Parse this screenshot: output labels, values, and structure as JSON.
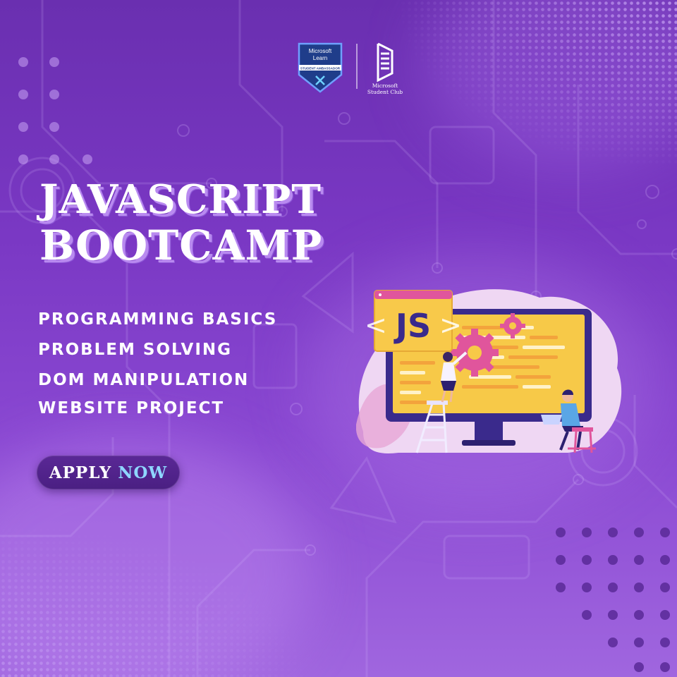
{
  "logos": {
    "badge_line1": "Microsoft",
    "badge_line2": "Learn",
    "badge_ribbon": "STUDENT AMBASSADOR",
    "club_line1": "Microsoft",
    "club_line2": "Student Club"
  },
  "headline": {
    "line1": "JAVASCRIPT",
    "line2": "BOOTCAMP"
  },
  "topics": [
    "PROGRAMMING BASICS",
    "PROBLEM SOLVING",
    "DOM MANIPULATION",
    "WEBSITE PROJECT"
  ],
  "cta": {
    "word1": "APPLY",
    "word2": "NOW"
  },
  "illustration": {
    "badge_text": "JS",
    "bracket_left": "<",
    "bracket_right": ">"
  },
  "colors": {
    "background_top": "#6a2fb0",
    "background_bottom": "#a066df",
    "cta_background": "#4a1f82",
    "cta_accent": "#8fd6ff",
    "screen_yellow": "#f7c948",
    "gear_pink": "#e0559c"
  }
}
